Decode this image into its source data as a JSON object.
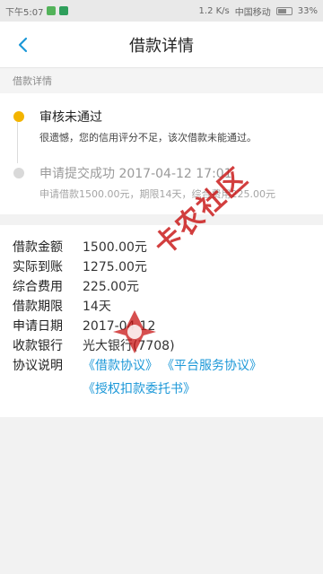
{
  "status_bar": {
    "time": "下午5:07",
    "speed": "1.2 K/s",
    "carrier": "中国移动",
    "battery": "33%"
  },
  "header": {
    "title": "借款详情"
  },
  "section": {
    "label": "借款详情"
  },
  "timeline": [
    {
      "title": "审核未通过",
      "desc": "很遗憾，您的信用评分不足，该次借款未能通过。",
      "state": "active"
    },
    {
      "title": "申请提交成功 2017-04-12 17:01",
      "desc": "申请借款1500.00元，期限14天，综合费用225.00元",
      "state": "done"
    }
  ],
  "details": {
    "amount_label": "借款金额",
    "amount_value": "1500.00元",
    "received_label": "实际到账",
    "received_value": "1275.00元",
    "fee_label": "综合费用",
    "fee_value": "225.00元",
    "term_label": "借款期限",
    "term_value": "14天",
    "date_label": "申请日期",
    "date_value": "2017-04-12",
    "bank_label": "收款银行",
    "bank_value": "光大银行(7708)",
    "agreements_label": "协议说明",
    "agreements": [
      "《借款协议》",
      "《平台服务协议》",
      "《授权扣款委托书》"
    ]
  },
  "watermark": {
    "text": "卡农社区"
  },
  "colors": {
    "accent_blue": "#1c98d8",
    "active_dot": "#f3b400",
    "inactive_dot": "#d9d9d9",
    "watermark_red": "#c81414"
  }
}
